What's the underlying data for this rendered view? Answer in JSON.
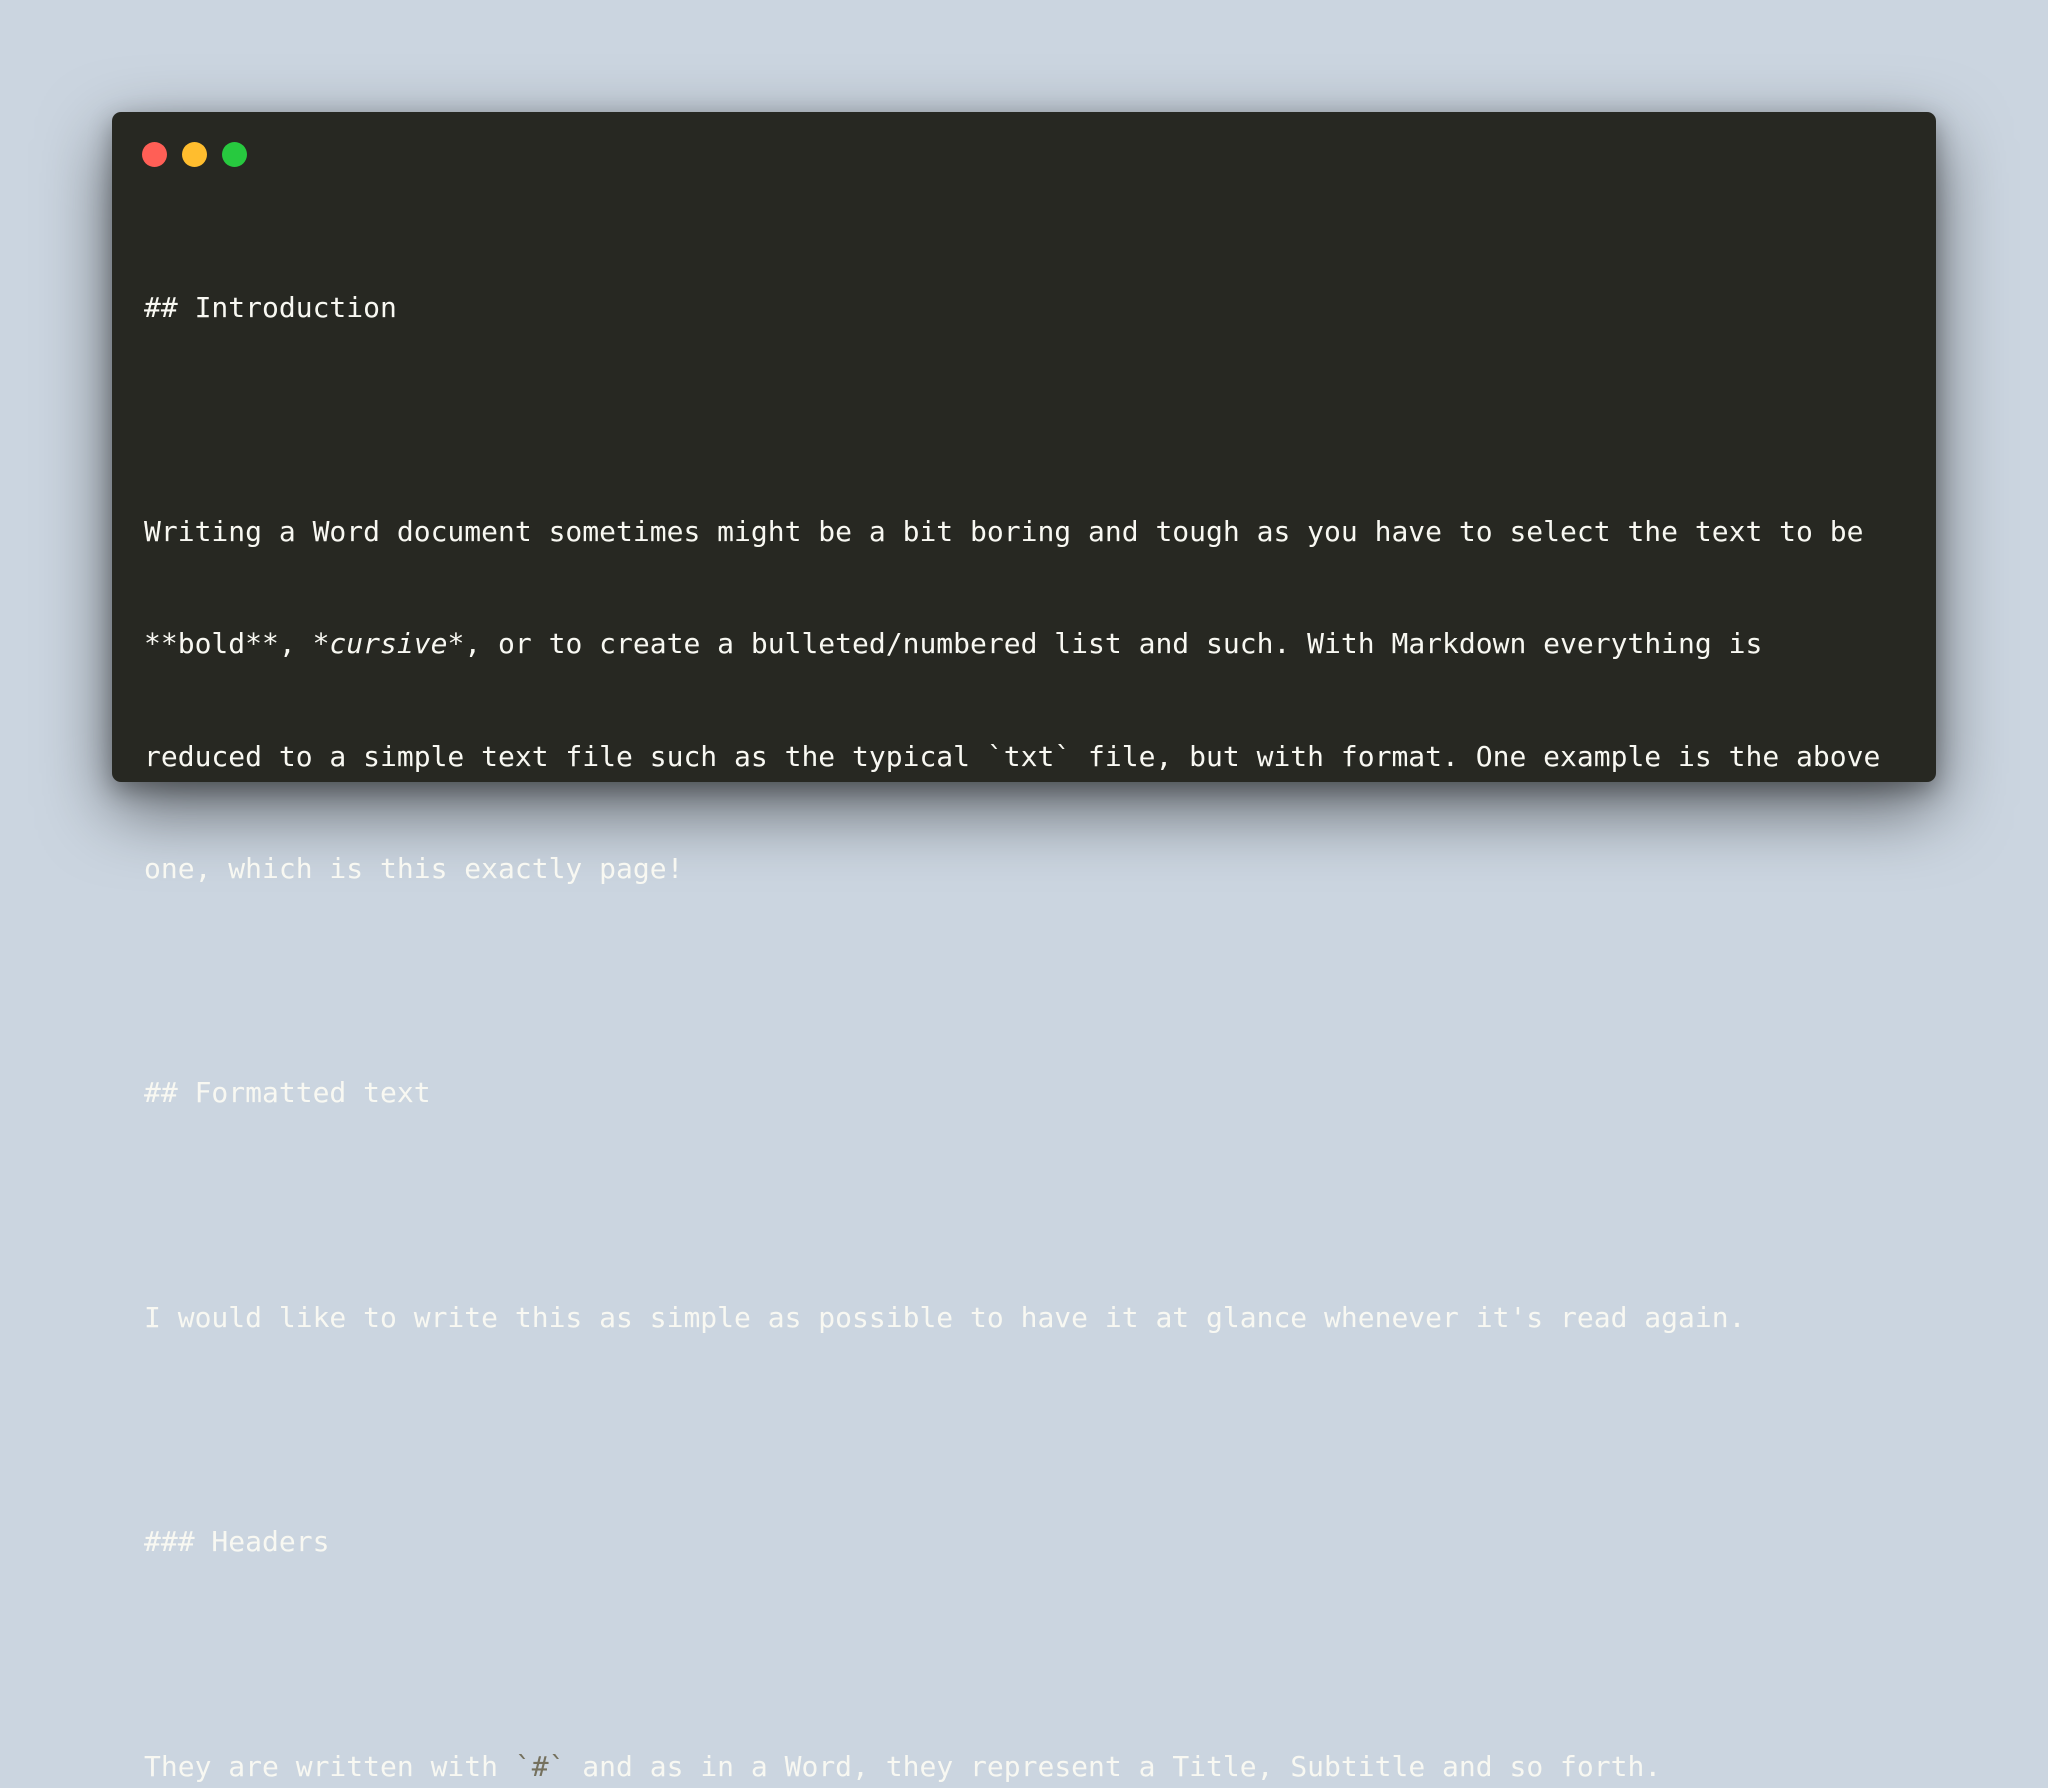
{
  "window": {
    "controls": {
      "close_color": "#ff5f56",
      "minimize_color": "#ffbd2e",
      "maximize_color": "#27c93f"
    }
  },
  "editor": {
    "lines": [
      "## Introduction",
      "",
      "Writing a Word document sometimes might be a bit boring and tough as you have to select the text to be",
      {
        "pre": "**bold**, ",
        "italic": "*cursive*",
        "post": ", or to create a bulleted/numbered list and such. With Markdown everything is"
      },
      "reduced to a simple text file such as the typical `txt` file, but with format. One example is the above",
      "one, which is this exactly page!",
      "",
      "## Formatted text",
      "",
      "I would like to write this as simple as possible to have it at glance whenever it's read again.",
      "",
      "### Headers",
      "",
      {
        "pre": "They are written with ",
        "code": "`#`",
        "post": " and as in a Word, they represent a Title, Subtitle and so forth."
      }
    ]
  },
  "colors": {
    "background": "#cbd5e0",
    "editor_background": "#272822",
    "text": "#f8f8f2",
    "code": "#75715e"
  }
}
